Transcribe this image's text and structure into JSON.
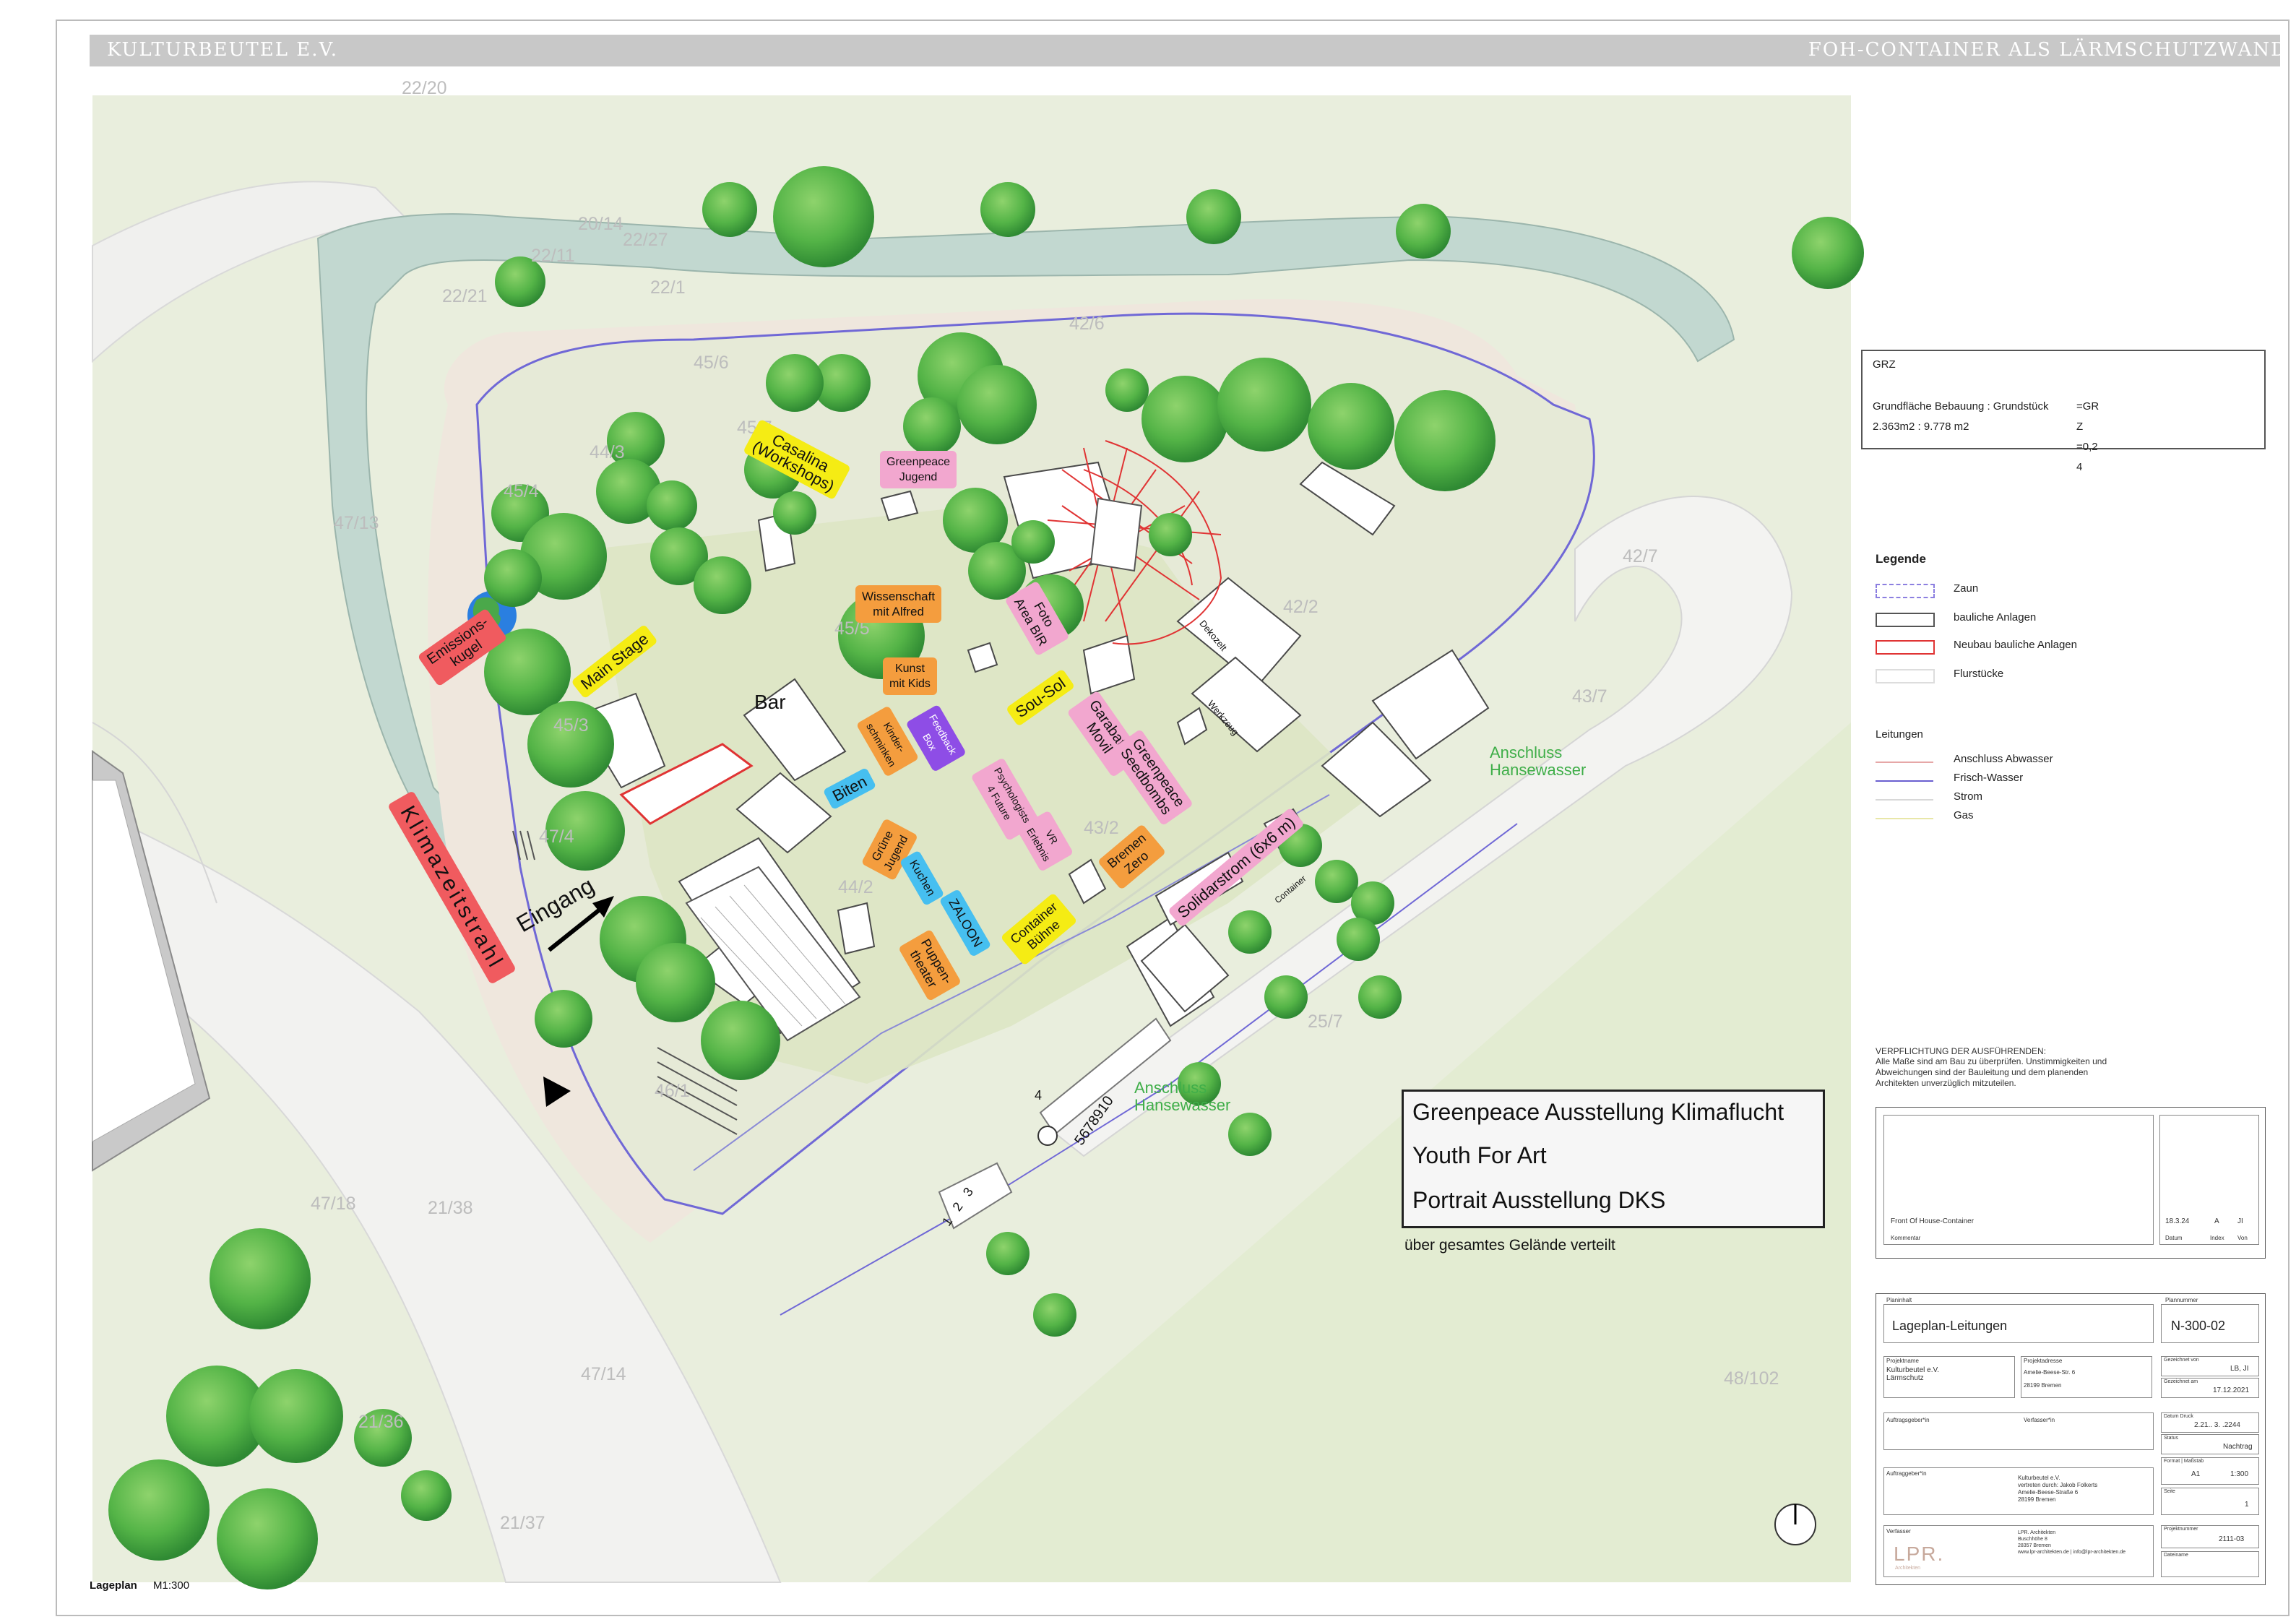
{
  "header": {
    "left": "KULTURBEUTEL E.V.",
    "right": "FOH-CONTAINER ALS LÄRMSCHUTZWAND"
  },
  "parcels": [
    "22/20",
    "20/14",
    "22/11",
    "22/27",
    "22/21",
    "22/1",
    "45/6",
    "42/6",
    "45/7",
    "44/3",
    "45/4",
    "47/13",
    "45/5",
    "42/2",
    "42/7",
    "45/3",
    "43/7",
    "43/2",
    "47/4",
    "44/2",
    "25/7",
    "46/1",
    "47/18",
    "21/38",
    "47/14",
    "48/102",
    "21/36",
    "21/37"
  ],
  "labels": {
    "casalina": "Casalina\n(Workshops)",
    "greenpeace_jugend": "Greenpeace\nJugend",
    "wissenschaft": "Wissenschaft\nmit Alfred",
    "kunst_kids": "Kunst\nmit Kids",
    "foto": "Foto\nArea BIR",
    "emission": "Emissions-\nkugel",
    "main_stage": "Main Stage",
    "bar": "Bar",
    "sou_sol": "Sou-Sol",
    "garabatos": "Garabatos\nMovil",
    "seedbombs": "Greenpeace\nSeedbombs",
    "kinder": "Kinder-\nschminken",
    "feedback": "Feedback\nBox",
    "psycho": "Psychologists\n4 Future",
    "vr": "VR\nErlebnis",
    "biten": "Biten",
    "klimazeitstrahl": "Klimazeitstrahl",
    "gruene_jugend": "Grüne\nJugend",
    "kuchen": "Kuchen",
    "zaloon": "ZALOON",
    "container_buehne": "Container\nBühne",
    "bremen_zero": "Bremen\nZero",
    "solidarstrom": "Solidarstrom (6x6 m)",
    "puppentheater": "Puppen-\ntheater",
    "eingang": "Eingang",
    "anschluss1": "Anschluss\nHansewasser",
    "anschluss2": "Anschluss\nHansewasser",
    "dekozelt": "Dekozelt",
    "werkzeug": "Werkzeug",
    "container_small": "Container",
    "num_4": "4",
    "num_code": "5678910",
    "num_parking": "1   2   3",
    "lageplan": "Lageplan",
    "scale": "M1:300"
  },
  "exhibitions": {
    "items": [
      "Greenpeace Ausstellung Klimaflucht",
      "Youth For Art",
      "Portrait Ausstellung DKS"
    ],
    "note": "über gesamtes Gelände verteilt"
  },
  "grz": {
    "title": "GRZ",
    "row1_left": "Grundfläche Bebauung : Grundstück",
    "row1_right": "=GR",
    "row2_left": "2.363m2 : 9.778 m2",
    "row2_right": "Z",
    "row3_right": "=0,2",
    "row4_right": "4"
  },
  "legend": {
    "title": "Legende",
    "items": [
      "Zaun",
      "bauliche Anlagen",
      "Neubau bauliche Anlagen",
      "Flurstücke"
    ],
    "leitungen_title": "Leitungen",
    "leitungen": [
      "Anschluss Abwasser",
      "Frisch-Wasser",
      "Strom",
      "Gas"
    ],
    "colors": {
      "zaun": "#8c7fe0",
      "neubau": "#e03434",
      "abwasser": "#e6a7a7",
      "frischwasser": "#6a5fd0",
      "strom": "#d8d8d8",
      "gas": "#e8e7a8"
    }
  },
  "verpflichtung": {
    "title": "VERPFLICHTUNG DER AUSFÜHRENDEN:",
    "text": "Alle Maße sind am Bau zu überprüfen. Unstimmigkeiten und\nAbweichungen sind der Bauleitung und dem planenden\nArchitekten unverzüglich mitzuteilen."
  },
  "revision": {
    "desc": "Front Of House-Container",
    "date": "18.3.24",
    "idx": "A",
    "by": "JI",
    "col1": "Kommentar",
    "col2": "Datum",
    "col3": "Index",
    "col4": "Von"
  },
  "titleblock": {
    "planinhalt_label": "Planinhalt",
    "planinhalt": "Lageplan-Leitungen",
    "plannummer_label": "Plannummer",
    "plannummer": "N-300-02",
    "projekt_label": "Projektname",
    "projekt": "Kulturbeutel e.V.\nLärmschutz",
    "adresse_label": "Projektadresse",
    "adresse": "Amelie-Beese-Str. 6\n\n28199 Bremen",
    "gez_label": "Gezeichnet von",
    "gez": "LB, JI",
    "gez2_label": "Gezeichnet am",
    "gez2": "17.12.2021",
    "datum_label": "Datum Druck",
    "datum": "2.21.. 3. .2244",
    "status_label": "Status",
    "status": "Nachtrag",
    "format_label": "Format | Maßstab",
    "format": "A1",
    "massstab": "1:300",
    "seite_label": "Seite",
    "seite": "1",
    "auftraggeber_label": "Auftraggeber*in",
    "auftraggeber": "Kulturbeutel e.V.\nvertreten durch: Jakob Folkerts\nAmelie-Beese-Straße 6\n28199 Bremen",
    "verfasser_label": "Verfasser",
    "verfasser": "LPR. Architekten\nBuschhöhe 8\n28357 Bremen\nwww.lpr-architekten.de | info@lpr-architekten.de",
    "logo": "LPR.",
    "logo_sub": "Architekten",
    "projektnummer_label": "Projektnummer",
    "projektnummer": "2111-03",
    "dateiname_label": "Dateiname"
  },
  "auftrag_labels": {
    "a": "Auftragsgeber*in",
    "b": "Verfasser*in"
  }
}
